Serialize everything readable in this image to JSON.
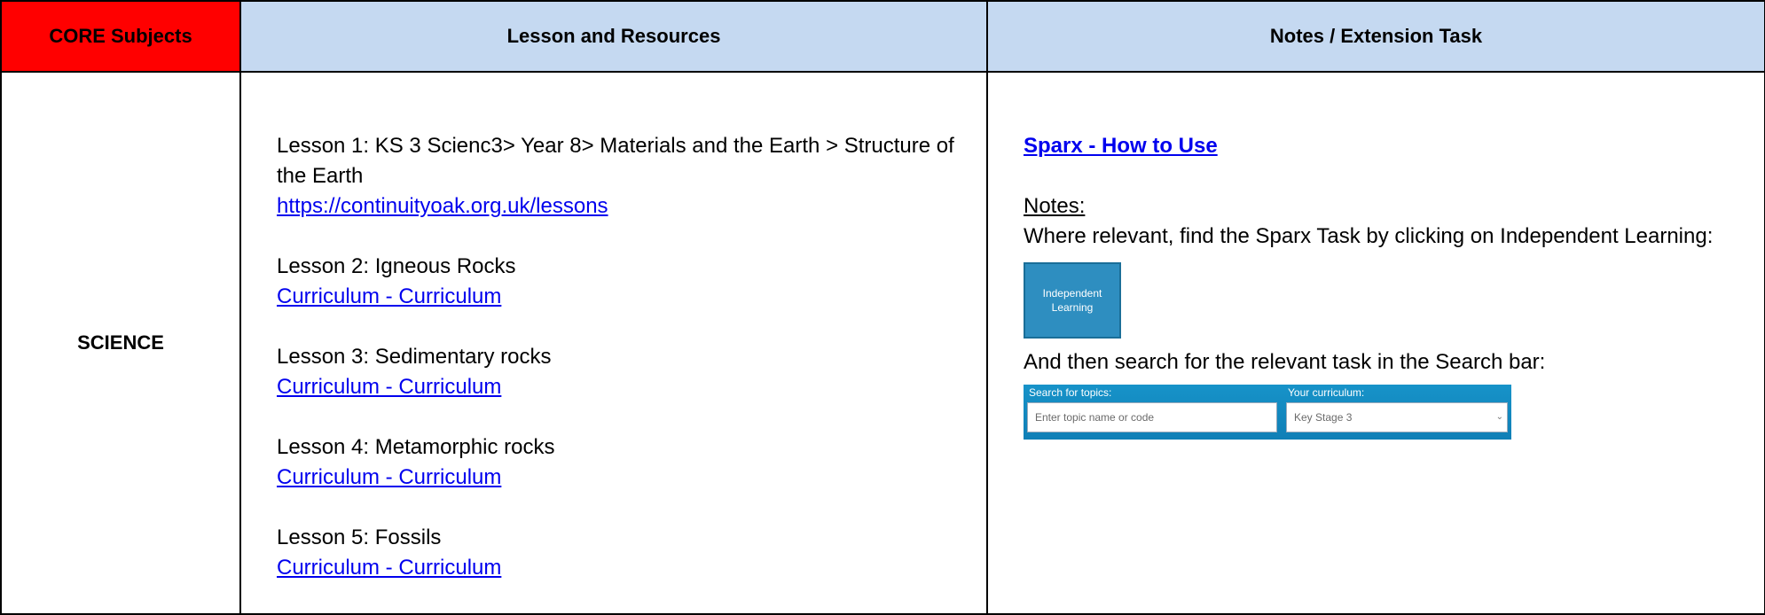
{
  "header": {
    "core_subjects": "CORE Subjects",
    "lesson_resources": "Lesson and Resources",
    "notes_extension": "Notes / Extension Task"
  },
  "subject": "SCIENCE",
  "lessons": [
    {
      "title": "Lesson 1: KS 3 Scienc3> Year 8> Materials and the Earth > Structure of the Earth",
      "link": "https://continuityoak.org.uk/lessons"
    },
    {
      "title": "Lesson 2: Igneous Rocks",
      "link": "Curriculum - Curriculum"
    },
    {
      "title": "Lesson 3:  Sedimentary rocks",
      "link": "Curriculum - Curriculum"
    },
    {
      "title": "Lesson 4: Metamorphic rocks",
      "link": "Curriculum - Curriculum"
    },
    {
      "title": "Lesson 5: Fossils",
      "link": "Curriculum - Curriculum"
    }
  ],
  "notes": {
    "sparx_link": "Sparx - How to Use",
    "label": "Notes:",
    "text": "Where relevant, find the Sparx Task by clicking on Independent Learning:",
    "independent_button": "Independent Learning",
    "search_text": "And then search for the relevant task in the Search bar:",
    "search_bar": {
      "topics_label": "Search for topics:",
      "curriculum_label": "Your curriculum:",
      "topic_placeholder": "Enter topic name or code",
      "curriculum_value": "Key Stage 3"
    }
  },
  "colors": {
    "core_header_bg": "#ff0000",
    "header_bg": "#c5d9f1",
    "link": "#0000ee",
    "button_bg": "#2e8ec0"
  }
}
